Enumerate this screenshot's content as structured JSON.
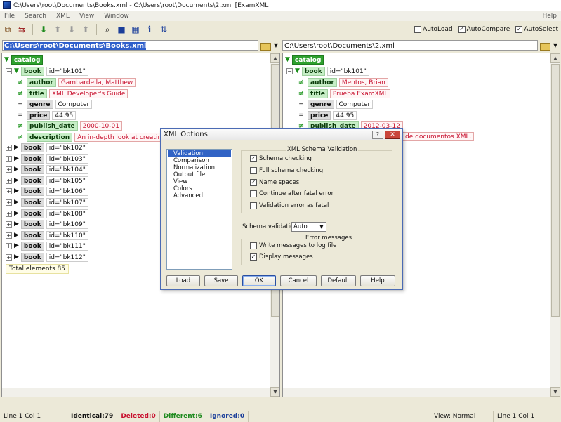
{
  "window": {
    "title": "C:\\Users\\root\\Documents\\Books.xml - C:\\Users\\root\\Documents\\2.xml [ExamXML"
  },
  "menu": {
    "items": [
      "File",
      "Search",
      "XML",
      "View",
      "Window"
    ],
    "help": "Help"
  },
  "toolbar": {
    "icons": [
      "compare-icon",
      "merge-icon",
      "next-down-icon",
      "up-icon",
      "down-icon",
      "up-alt-icon",
      "find-icon",
      "save-icon",
      "grid-icon",
      "info-icon",
      "sort-icon"
    ],
    "checks": [
      {
        "label": "AutoLoad",
        "checked": false
      },
      {
        "label": "AutoCompare",
        "checked": true
      },
      {
        "label": "AutoSelect",
        "checked": true
      }
    ]
  },
  "left": {
    "path": "C:\\Users\\root\\Documents\\Books.xml",
    "root": "catalog",
    "book": {
      "tag": "book",
      "attr": "id=\"bk101\""
    },
    "fields": [
      {
        "mark": "≠",
        "tag": "author",
        "value": "Gambardella, Matthew",
        "diff": true
      },
      {
        "mark": "≠",
        "tag": "title",
        "value": "XML Developer's Guide",
        "diff": true
      },
      {
        "mark": "=",
        "tag": "genre",
        "value": "Computer",
        "diff": false
      },
      {
        "mark": "=",
        "tag": "price",
        "value": "44.95",
        "diff": false
      },
      {
        "mark": "≠",
        "tag": "publish_date",
        "value": "2000-10-01",
        "diff": true
      },
      {
        "mark": "≠",
        "tag": "description",
        "value": "An in-depth look at creating",
        "diff": true
      }
    ],
    "collapsed": [
      "id=\"bk102\"",
      "id=\"bk103\"",
      "id=\"bk104\"",
      "id=\"bk105\"",
      "id=\"bk106\"",
      "id=\"bk107\"",
      "id=\"bk108\"",
      "id=\"bk109\"",
      "id=\"bk110\"",
      "id=\"bk111\"",
      "id=\"bk112\""
    ],
    "total": "Total elements 85"
  },
  "right": {
    "path": "C:\\Users\\root\\Documents\\2.xml",
    "root": "catalog",
    "book": {
      "tag": "book",
      "attr": "id=\"bk101\""
    },
    "fields": [
      {
        "mark": "≠",
        "tag": "author",
        "value": "Mentos, Brian",
        "diff": true
      },
      {
        "mark": "≠",
        "tag": "title",
        "value": "Prueba ExamXML",
        "diff": true
      },
      {
        "mark": "=",
        "tag": "genre",
        "value": "Computer",
        "diff": false
      },
      {
        "mark": "=",
        "tag": "price",
        "value": "44.95",
        "diff": false
      },
      {
        "mark": "≠",
        "tag": "publish_date",
        "value": "2012-03-12",
        "diff": true
      }
    ],
    "desc_tail": "de documentos XML."
  },
  "dialog": {
    "title": "XML Options",
    "help_glyph": "?",
    "close_glyph": "✕",
    "categories": [
      "Validation",
      "Comparison",
      "Normalization",
      "Output file",
      "View",
      "Colors",
      "Advanced"
    ],
    "schema_group": "XML Schema Validation",
    "options": [
      {
        "label": "Schema checking",
        "checked": true
      },
      {
        "label": "Full schema checking",
        "checked": false
      },
      {
        "label": "Name spaces",
        "checked": true
      },
      {
        "label": "Continue after fatal error",
        "checked": false
      },
      {
        "label": "Validation error as fatal",
        "checked": false
      }
    ],
    "schema_validation_label": "Schema validation:",
    "schema_validation_value": "Auto",
    "error_group": "Error messages",
    "error_options": [
      {
        "label": "Write messages to log file",
        "checked": false
      },
      {
        "label": "Display messages",
        "checked": true
      }
    ],
    "buttons": [
      "Load",
      "Save",
      "OK",
      "Cancel",
      "Default",
      "Help"
    ]
  },
  "status": {
    "left_pos": "Line 1  Col 1",
    "identical": "Identical:79",
    "deleted": "Deleted:0",
    "different": "Different:6",
    "ignored": "Ignored:0",
    "view": "View: Normal",
    "right_pos": "Line 1  Col 1"
  }
}
